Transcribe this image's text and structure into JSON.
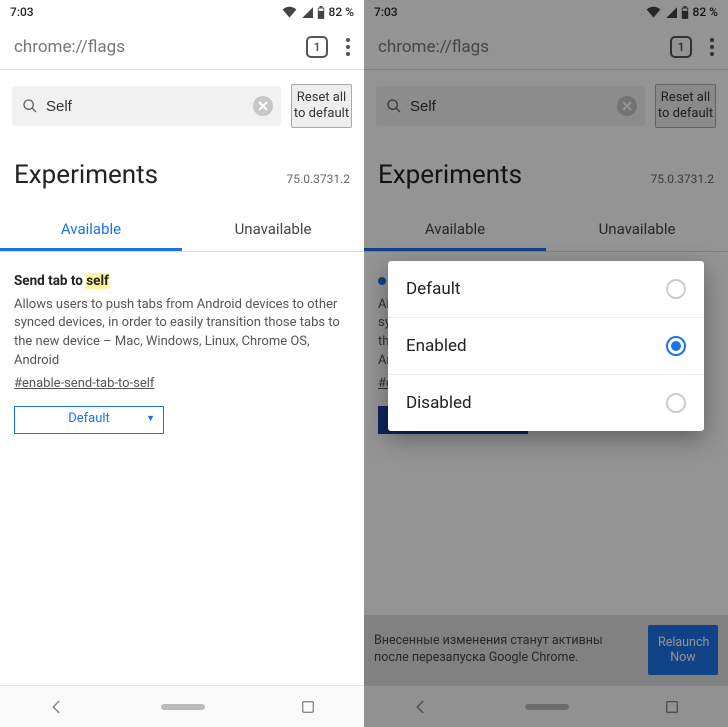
{
  "status": {
    "time": "7:03",
    "battery": "82 %"
  },
  "omnibox": {
    "url": "chrome://flags",
    "tab_count": "1"
  },
  "search": {
    "value": "Self"
  },
  "buttons": {
    "reset": "Reset all to default"
  },
  "experiments": {
    "title": "Experiments",
    "version": "75.0.3731.2"
  },
  "tabs": {
    "available": "Available",
    "unavailable": "Unavailable"
  },
  "flag": {
    "title_prefix": "Send tab to ",
    "title_highlight": "self",
    "description": "Allows users to push tabs from Android devices to other synced devices, in order to easily transition those tabs to the new device – Mac, Windows, Linux, Chrome OS, Android",
    "hash": "#enable-send-tab-to-self",
    "select_value": "Default"
  },
  "dialog": {
    "options": {
      "default": "Default",
      "enabled": "Enabled",
      "disabled": "Disabled"
    }
  },
  "relaunch": {
    "text": "Внесенные изменения станут активны после перезапуска Google Chrome.",
    "button": "Relaunch Now"
  }
}
